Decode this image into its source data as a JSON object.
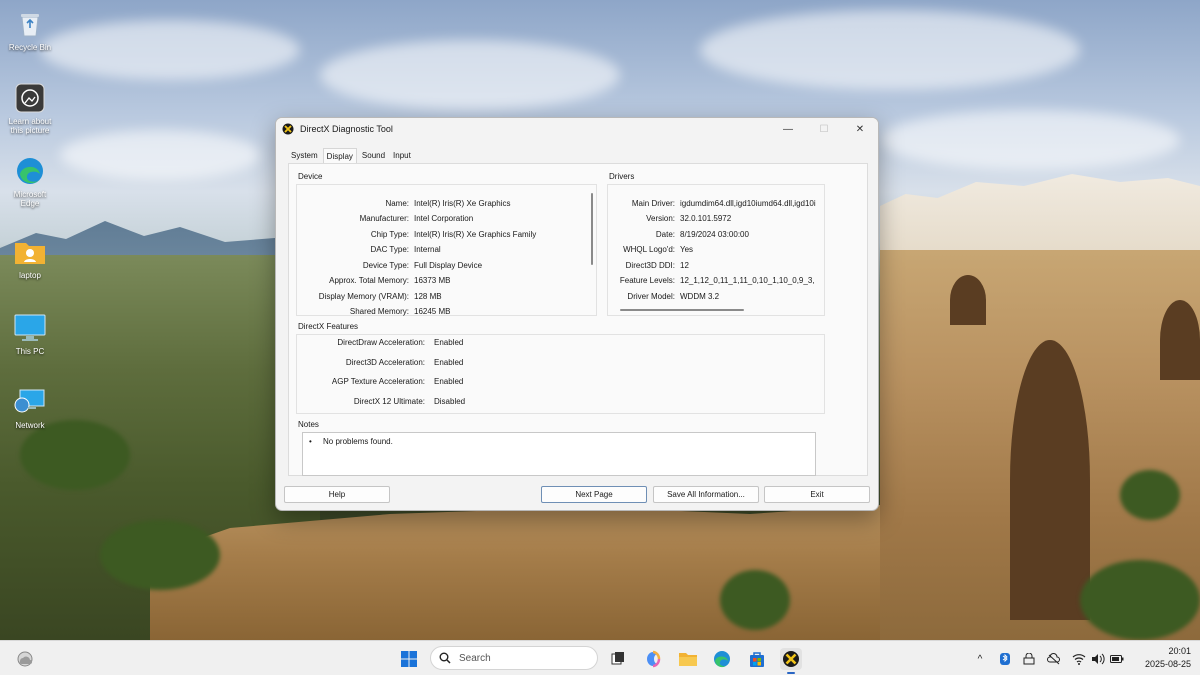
{
  "desktop": {
    "icons": [
      {
        "label": "Recycle Bin"
      },
      {
        "label": "Learn about this picture"
      },
      {
        "label": "Microsoft Edge"
      },
      {
        "label": "laptop"
      },
      {
        "label": "This PC"
      },
      {
        "label": "Network"
      }
    ]
  },
  "window": {
    "title": "DirectX Diagnostic Tool",
    "controls": {
      "minimize": "—",
      "maximize": "☐",
      "close": "✕"
    },
    "tabs": [
      {
        "label": "System",
        "active": false
      },
      {
        "label": "Display",
        "active": true
      },
      {
        "label": "Sound",
        "active": false
      },
      {
        "label": "Input",
        "active": false
      }
    ],
    "device": {
      "heading": "Device",
      "rows": [
        {
          "key": "Name:",
          "value": "Intel(R) Iris(R) Xe Graphics"
        },
        {
          "key": "Manufacturer:",
          "value": "Intel Corporation"
        },
        {
          "key": "Chip Type:",
          "value": "Intel(R) Iris(R) Xe Graphics Family"
        },
        {
          "key": "DAC Type:",
          "value": "Internal"
        },
        {
          "key": "Device Type:",
          "value": "Full Display Device"
        },
        {
          "key": "Approx. Total Memory:",
          "value": "16373 MB"
        },
        {
          "key": "Display Memory (VRAM):",
          "value": "128 MB"
        },
        {
          "key": "Shared Memory:",
          "value": "16245 MB"
        }
      ]
    },
    "drivers": {
      "heading": "Drivers",
      "rows": [
        {
          "key": "Main Driver:",
          "value": "igdumdim64.dll,igd10iumd64.dll,igd10i"
        },
        {
          "key": "Version:",
          "value": "32.0.101.5972"
        },
        {
          "key": "Date:",
          "value": "8/19/2024 03:00:00"
        },
        {
          "key": "WHQL Logo'd:",
          "value": "Yes"
        },
        {
          "key": "Direct3D DDI:",
          "value": "12"
        },
        {
          "key": "Feature Levels:",
          "value": "12_1,12_0,11_1,11_0,10_1,10_0,9_3,"
        },
        {
          "key": "Driver Model:",
          "value": "WDDM 3.2"
        }
      ]
    },
    "features": {
      "heading": "DirectX Features",
      "rows": [
        {
          "key": "DirectDraw Acceleration:",
          "value": "Enabled"
        },
        {
          "key": "Direct3D Acceleration:",
          "value": "Enabled"
        },
        {
          "key": "AGP Texture Acceleration:",
          "value": "Enabled"
        },
        {
          "key": "DirectX 12 Ultimate:",
          "value": "Disabled"
        }
      ]
    },
    "notes": {
      "heading": "Notes",
      "bullet": "•",
      "items": [
        "No problems found."
      ]
    },
    "buttons": {
      "help": "Help",
      "next": "Next Page",
      "save": "Save All Information...",
      "exit": "Exit"
    }
  },
  "taskbar": {
    "search_placeholder": "Search",
    "clock_time": "20:01",
    "clock_date": "2025-08-25",
    "tray_chevron": "^"
  }
}
